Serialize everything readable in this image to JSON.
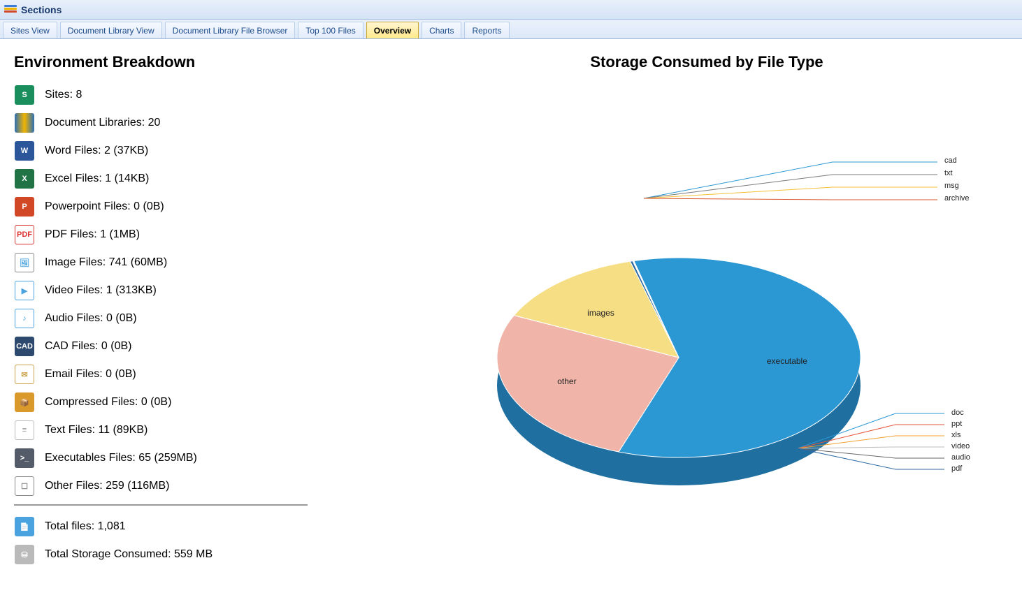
{
  "header": {
    "title": "Sections"
  },
  "tabs": [
    {
      "label": "Sites View",
      "active": false
    },
    {
      "label": "Document Library View",
      "active": false
    },
    {
      "label": "Document Library File Browser",
      "active": false
    },
    {
      "label": "Top 100 Files",
      "active": false
    },
    {
      "label": "Overview",
      "active": true
    },
    {
      "label": "Charts",
      "active": false
    },
    {
      "label": "Reports",
      "active": false
    }
  ],
  "breakdown": {
    "title": "Environment Breakdown",
    "rows": [
      {
        "icon": "sharepoint-icon",
        "iconClass": "ico-sp",
        "text": "Sites: 8"
      },
      {
        "icon": "library-icon",
        "iconClass": "ico-lib",
        "text": "Document Libraries:  20"
      },
      {
        "icon": "word-icon",
        "iconClass": "ico-word",
        "text": "Word Files: 2 (37KB)"
      },
      {
        "icon": "excel-icon",
        "iconClass": "ico-xls",
        "text": "Excel Files: 1 (14KB)"
      },
      {
        "icon": "powerpoint-icon",
        "iconClass": "ico-ppt",
        "text": "Powerpoint Files:  0 (0B)"
      },
      {
        "icon": "pdf-icon",
        "iconClass": "ico-pdf",
        "text": "PDF Files: 1 (1MB)"
      },
      {
        "icon": "image-icon",
        "iconClass": "ico-img",
        "text": "Image Files:  741 (60MB)"
      },
      {
        "icon": "video-icon",
        "iconClass": "ico-vid",
        "text": "Video Files: 1 (313KB)"
      },
      {
        "icon": "audio-icon",
        "iconClass": "ico-aud",
        "text": "Audio Files:  0 (0B)"
      },
      {
        "icon": "cad-icon",
        "iconClass": "ico-cad",
        "text": "CAD Files: 0 (0B)"
      },
      {
        "icon": "email-icon",
        "iconClass": "ico-mail",
        "text": "Email Files:  0 (0B)"
      },
      {
        "icon": "archive-icon",
        "iconClass": "ico-zip",
        "text": "Compressed Files:  0 (0B)"
      },
      {
        "icon": "text-icon",
        "iconClass": "ico-txt",
        "text": "Text Files: 11 (89KB)"
      },
      {
        "icon": "exe-icon",
        "iconClass": "ico-exe",
        "text": "Executables Files:  65 (259MB)"
      },
      {
        "icon": "other-icon",
        "iconClass": "ico-oth",
        "text": "Other Files: 259 (116MB)"
      }
    ],
    "totals": [
      {
        "icon": "files-icon",
        "iconClass": "ico-files",
        "text": "Total files:  1,081"
      },
      {
        "icon": "storage-icon",
        "iconClass": "ico-db",
        "text": "Total Storage Consumed:  559 MB"
      }
    ]
  },
  "chart_data": {
    "type": "pie",
    "title": "Storage Consumed by File Type",
    "unit": "MB",
    "series": [
      {
        "name": "executable",
        "value": 259,
        "color": "#2b98d4"
      },
      {
        "name": "other",
        "value": 116,
        "color": "#f0b5a8"
      },
      {
        "name": "images",
        "value": 60,
        "color": "#f6de84"
      },
      {
        "name": "pdf",
        "value": 1,
        "color": "#2d6aa3"
      },
      {
        "name": "video",
        "value": 0.313,
        "color": "#bdbdbd"
      },
      {
        "name": "txt",
        "value": 0.089,
        "color": "#7a7a7a"
      },
      {
        "name": "doc",
        "value": 0.037,
        "color": "#2b98d4"
      },
      {
        "name": "xls",
        "value": 0.014,
        "color": "#f0a030"
      },
      {
        "name": "ppt",
        "value": 0,
        "color": "#e6563a"
      },
      {
        "name": "audio",
        "value": 0,
        "color": "#666"
      },
      {
        "name": "msg",
        "value": 0,
        "color": "#f6de84"
      },
      {
        "name": "archive",
        "value": 0,
        "color": "#d85a2d"
      },
      {
        "name": "cad",
        "value": 0,
        "color": "#2b98d4"
      }
    ],
    "inline_labels": [
      "executable",
      "other",
      "images"
    ],
    "leaders_top": [
      "cad",
      "txt",
      "msg",
      "archive"
    ],
    "leaders_right": [
      "doc",
      "ppt",
      "xls",
      "video",
      "audio",
      "pdf"
    ]
  }
}
